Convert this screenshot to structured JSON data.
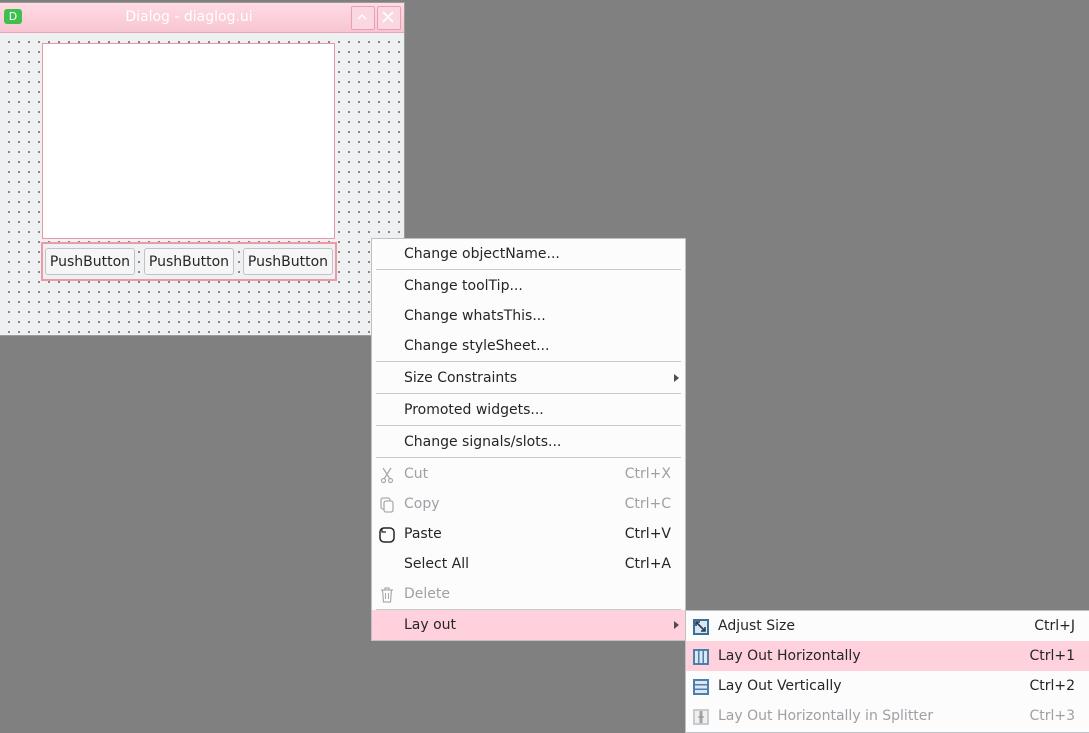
{
  "window": {
    "title": "Dialog - diaglog.ui",
    "app_icon_letter": "D"
  },
  "dialog": {
    "buttons": [
      "PushButton",
      "PushButton",
      "PushButton"
    ]
  },
  "context_menu": {
    "items": [
      {
        "label": "Change objectName...",
        "shortcut": "",
        "enabled": true
      },
      {
        "label": "Change toolTip...",
        "shortcut": "",
        "enabled": true
      },
      {
        "label": "Change whatsThis...",
        "shortcut": "",
        "enabled": true
      },
      {
        "label": "Change styleSheet...",
        "shortcut": "",
        "enabled": true
      },
      {
        "label": "Size Constraints",
        "shortcut": "",
        "enabled": true,
        "submenu": true
      },
      {
        "label": "Promoted widgets...",
        "shortcut": "",
        "enabled": true
      },
      {
        "label": "Change signals/slots...",
        "shortcut": "",
        "enabled": true
      },
      {
        "label": "Cut",
        "shortcut": "Ctrl+X",
        "enabled": false,
        "icon": "scissors-icon"
      },
      {
        "label": "Copy",
        "shortcut": "Ctrl+C",
        "enabled": false,
        "icon": "copy-icon"
      },
      {
        "label": "Paste",
        "shortcut": "Ctrl+V",
        "enabled": true,
        "icon": "paste-icon"
      },
      {
        "label": "Select All",
        "shortcut": "Ctrl+A",
        "enabled": true
      },
      {
        "label": "Delete",
        "shortcut": "",
        "enabled": false,
        "icon": "trash-icon"
      },
      {
        "label": "Lay out",
        "shortcut": "",
        "enabled": true,
        "submenu": true,
        "highlighted": true
      }
    ]
  },
  "layout_submenu": {
    "items": [
      {
        "label": "Adjust Size",
        "shortcut": "Ctrl+J",
        "enabled": true,
        "icon": "adjust-size-icon"
      },
      {
        "label": "Lay Out Horizontally",
        "shortcut": "Ctrl+1",
        "enabled": true,
        "highlighted": true,
        "icon": "layout-horizontal-icon"
      },
      {
        "label": "Lay Out Vertically",
        "shortcut": "Ctrl+2",
        "enabled": true,
        "icon": "layout-vertical-icon"
      },
      {
        "label": "Lay Out Horizontally in Splitter",
        "shortcut": "Ctrl+3",
        "enabled": false,
        "icon": "splitter-horizontal-icon"
      }
    ]
  },
  "colors": {
    "highlight": "#ffd1dc",
    "titlebar": "#f7c6d2",
    "desktop": "#808080",
    "selection_border": "#ee9aa6"
  }
}
